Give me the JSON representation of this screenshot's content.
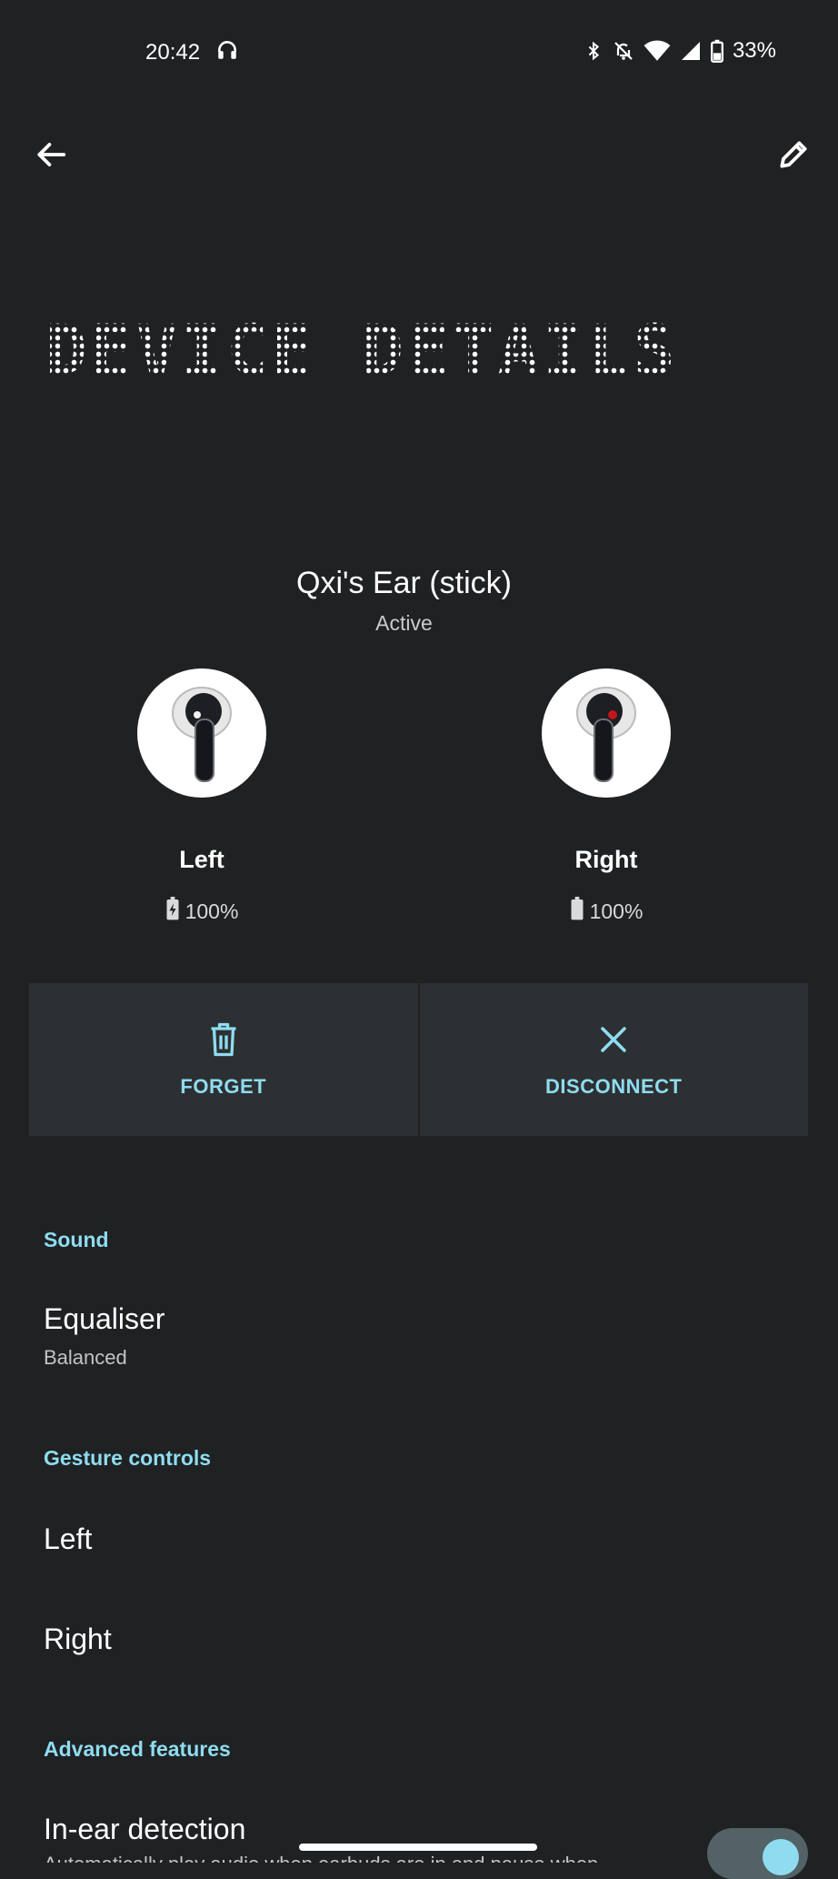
{
  "status_bar": {
    "time": "20:42",
    "battery": "33%",
    "icons": [
      "headphones-icon",
      "bluetooth-icon",
      "notifications-off-icon",
      "wifi-icon",
      "cellular-signal-icon",
      "battery-icon"
    ]
  },
  "header": {
    "title": "DEVICE DETAILS"
  },
  "device": {
    "name": "Qxi's Ear (stick)",
    "status": "Active",
    "left": {
      "label": "Left",
      "battery": "100%"
    },
    "right": {
      "label": "Right",
      "battery": "100%"
    }
  },
  "actions": {
    "forget": "FORGET",
    "disconnect": "DISCONNECT"
  },
  "sections": {
    "sound": {
      "header": "Sound",
      "equaliser_title": "Equaliser",
      "equaliser_value": "Balanced"
    },
    "gestures": {
      "header": "Gesture controls",
      "left": "Left",
      "right": "Right"
    },
    "advanced": {
      "header": "Advanced features",
      "in_ear_title": "In-ear detection",
      "in_ear_sub": "Automatically play audio when earbuds are in and pause when",
      "in_ear_enabled": true
    }
  },
  "colors": {
    "background": "#1f2123",
    "accent": "#8fdcf0",
    "button_bg": "#2d3032"
  }
}
